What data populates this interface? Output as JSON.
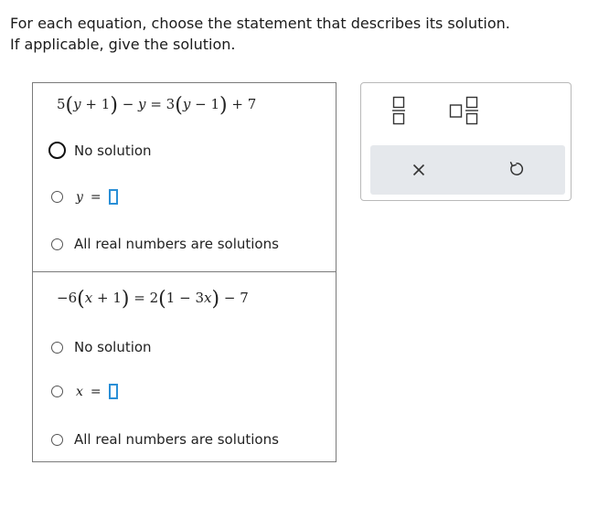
{
  "instructions": {
    "line1": "For each equation, choose the statement that describes its solution.",
    "line2": "If applicable, give the solution."
  },
  "problems": [
    {
      "equation": {
        "c1": "5",
        "p1": "y",
        "plus1": "+",
        "n1": "1",
        "minus1": "−",
        "v1": "y",
        "eq": "=",
        "c2": "3",
        "p2": "y",
        "minus2": "−",
        "n2": "1",
        "plus2": "+",
        "n3": "7"
      },
      "options": {
        "no_solution": "No solution",
        "variable": "y",
        "equals": "=",
        "all_real": "All real numbers are solutions"
      },
      "selected": "no_solution"
    },
    {
      "equation": {
        "c1": "−6",
        "p1": "x",
        "plus1": "+",
        "n1": "1",
        "eq": "=",
        "c2": "2",
        "n2": "1",
        "minus1": "−",
        "term": "3",
        "v2": "x",
        "minus2": "−",
        "n3": "7"
      },
      "options": {
        "no_solution": "No solution",
        "variable": "x",
        "equals": "=",
        "all_real": "All real numbers are solutions"
      },
      "selected": null
    }
  ],
  "toolbar": {
    "tools": [
      "fraction-icon",
      "mixed-number-icon"
    ],
    "actions": [
      "clear-icon",
      "undo-icon"
    ]
  }
}
